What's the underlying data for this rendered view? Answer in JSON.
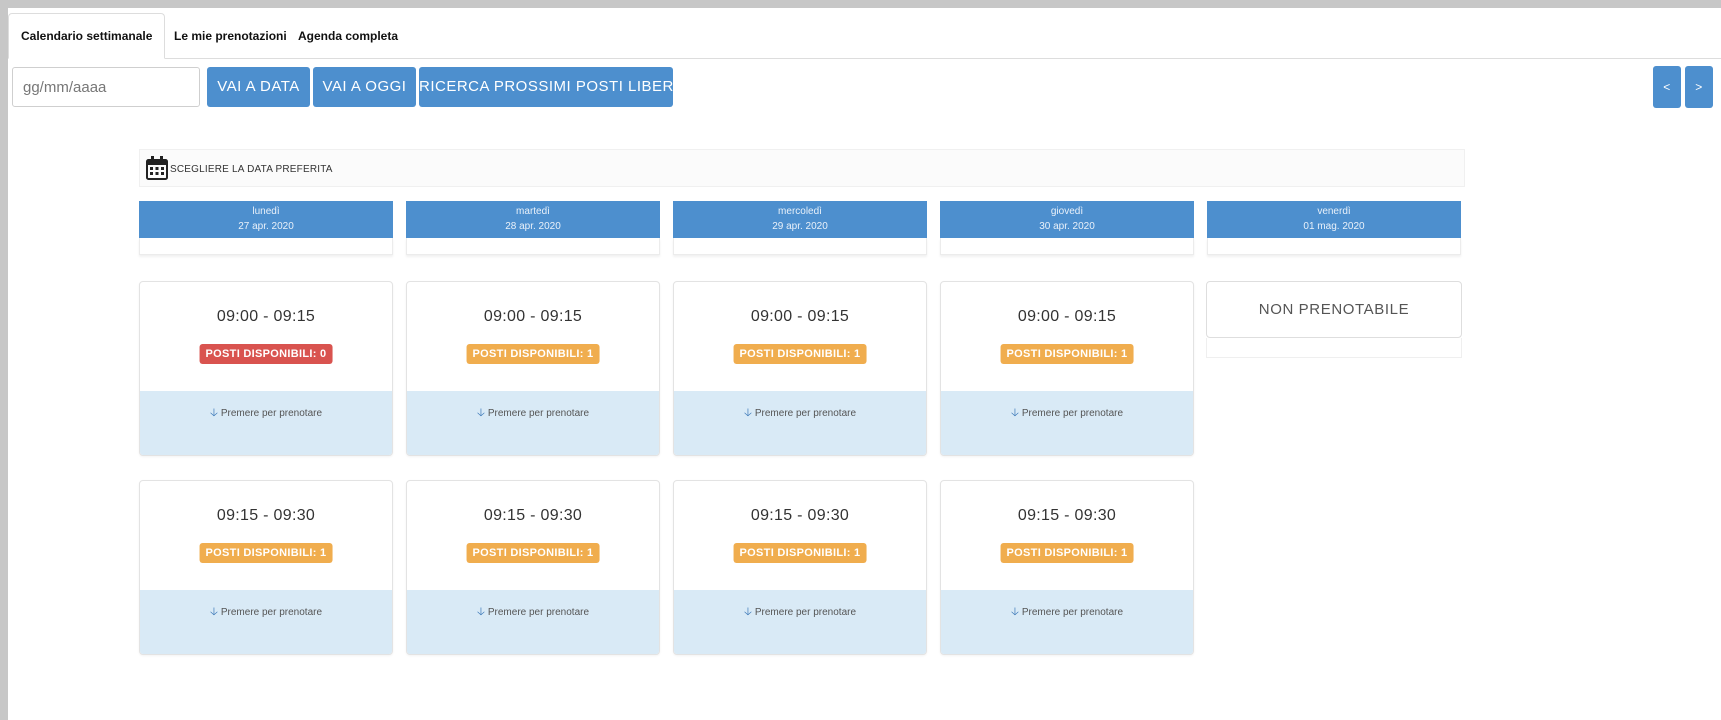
{
  "tabs": [
    {
      "label": "Calendario settimanale",
      "active": true
    },
    {
      "label": "Le mie prenotazioni",
      "active": false
    },
    {
      "label": "Agenda completa",
      "active": false
    }
  ],
  "toolbar": {
    "date_placeholder": "gg/mm/aaaa",
    "goto_date": "VAI A DATA",
    "goto_today": "VAI A OGGI",
    "search_next": "RICERCA PROSSIMI POSTI LIBERI",
    "prev": "<",
    "next": ">"
  },
  "calendar": {
    "choose_label": "SCEGLIERE LA DATA PREFERITA",
    "days": [
      {
        "name": "lunedì",
        "date": "27 apr. 2020"
      },
      {
        "name": "martedì",
        "date": "28 apr. 2020"
      },
      {
        "name": "mercoledì",
        "date": "29 apr. 2020"
      },
      {
        "name": "giovedì",
        "date": "30 apr. 2020"
      },
      {
        "name": "venerdì",
        "date": "01 mag. 2020"
      }
    ],
    "not_bookable": "NON PRENOTABILE",
    "book_label": "Premere per prenotare",
    "slots": [
      {
        "time": "09:00 - 09:15",
        "badges": [
          "POSTI DISPONIBILI: 0",
          "POSTI DISPONIBILI: 1",
          "POSTI DISPONIBILI: 1",
          "POSTI DISPONIBILI: 1"
        ]
      },
      {
        "time": "09:15 - 09:30",
        "badges": [
          "POSTI DISPONIBILI: 1",
          "POSTI DISPONIBILI: 1",
          "POSTI DISPONIBILI: 1",
          "POSTI DISPONIBILI: 1"
        ]
      }
    ]
  },
  "colors": {
    "primary": "#4d8fce",
    "badge_zero": "#d9534f",
    "badge_available": "#f0ad4e",
    "slot_footer": "#d9eaf6"
  }
}
